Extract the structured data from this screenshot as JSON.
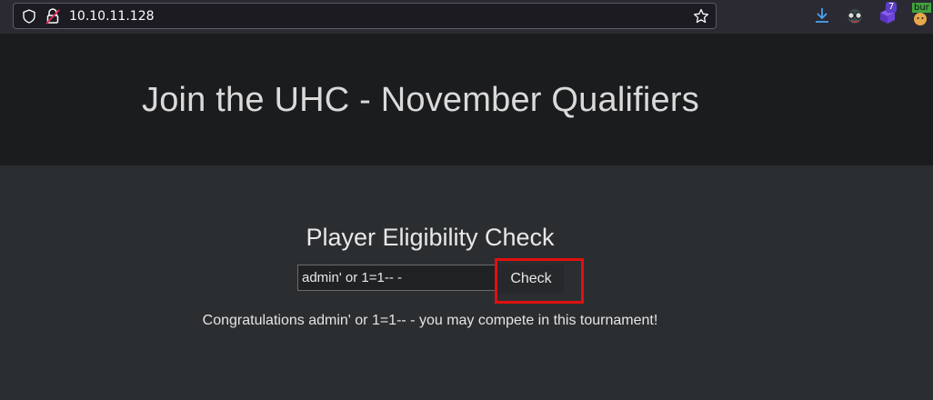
{
  "browser": {
    "url": "10.10.11.128",
    "extensions": {
      "download_icon": "download-icon",
      "glasses_icon": "glasses-icon",
      "cube_badge": "7",
      "burp_label": "bur"
    }
  },
  "header": {
    "title": "Join the UHC - November Qualifiers"
  },
  "main": {
    "heading": "Player Eligibility Check",
    "input_value": "admin' or 1=1-- -",
    "check_label": "Check",
    "result": "Congratulations admin' or 1=1-- - you may compete in this tournament!"
  },
  "colors": {
    "highlight": "#e01010",
    "header_bg": "#1b1c1e",
    "page_bg": "#2b2e31"
  }
}
